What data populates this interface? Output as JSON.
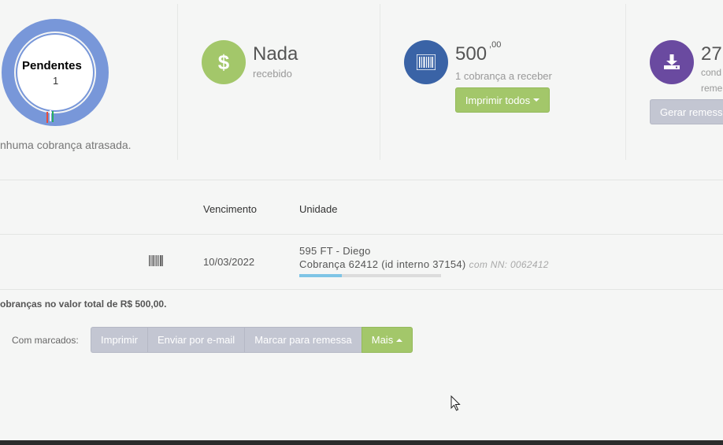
{
  "pending": {
    "title": "Pendentes",
    "count": "1",
    "late_text": "nhuma cobrança atrasada."
  },
  "received": {
    "value": "Nada",
    "label": "recebido"
  },
  "to_receive": {
    "value": "500",
    "cents": ",00",
    "label": "1 cobrança a receber",
    "print_all_label": "Imprimir todos"
  },
  "remittance": {
    "value": "27",
    "label_line1": "cond",
    "label_line2": "reme",
    "button_label": "Gerar remessa"
  },
  "table": {
    "headers": {
      "due": "Vencimento",
      "unit": "Unidade"
    },
    "rows": [
      {
        "due_date": "10/03/2022",
        "unit_name": "595 FT - Diego",
        "charge": "Cobrança 62412 (id interno 37154)",
        "nn": "com NN: 0062412",
        "progress": 0.3
      }
    ]
  },
  "summary": {
    "total_text": "obranças no valor total de R$ 500,00."
  },
  "bulk_actions": {
    "label": "Com marcados:",
    "print": "Imprimir",
    "email": "Enviar por e-mail",
    "mark": "Marcar para remessa",
    "more": "Mais"
  },
  "colors": {
    "donut": "#7897d9",
    "green": "#a3c76a",
    "blue": "#3a63a6",
    "purple": "#6a4aa0",
    "gray_button": "#c3c6d2"
  }
}
